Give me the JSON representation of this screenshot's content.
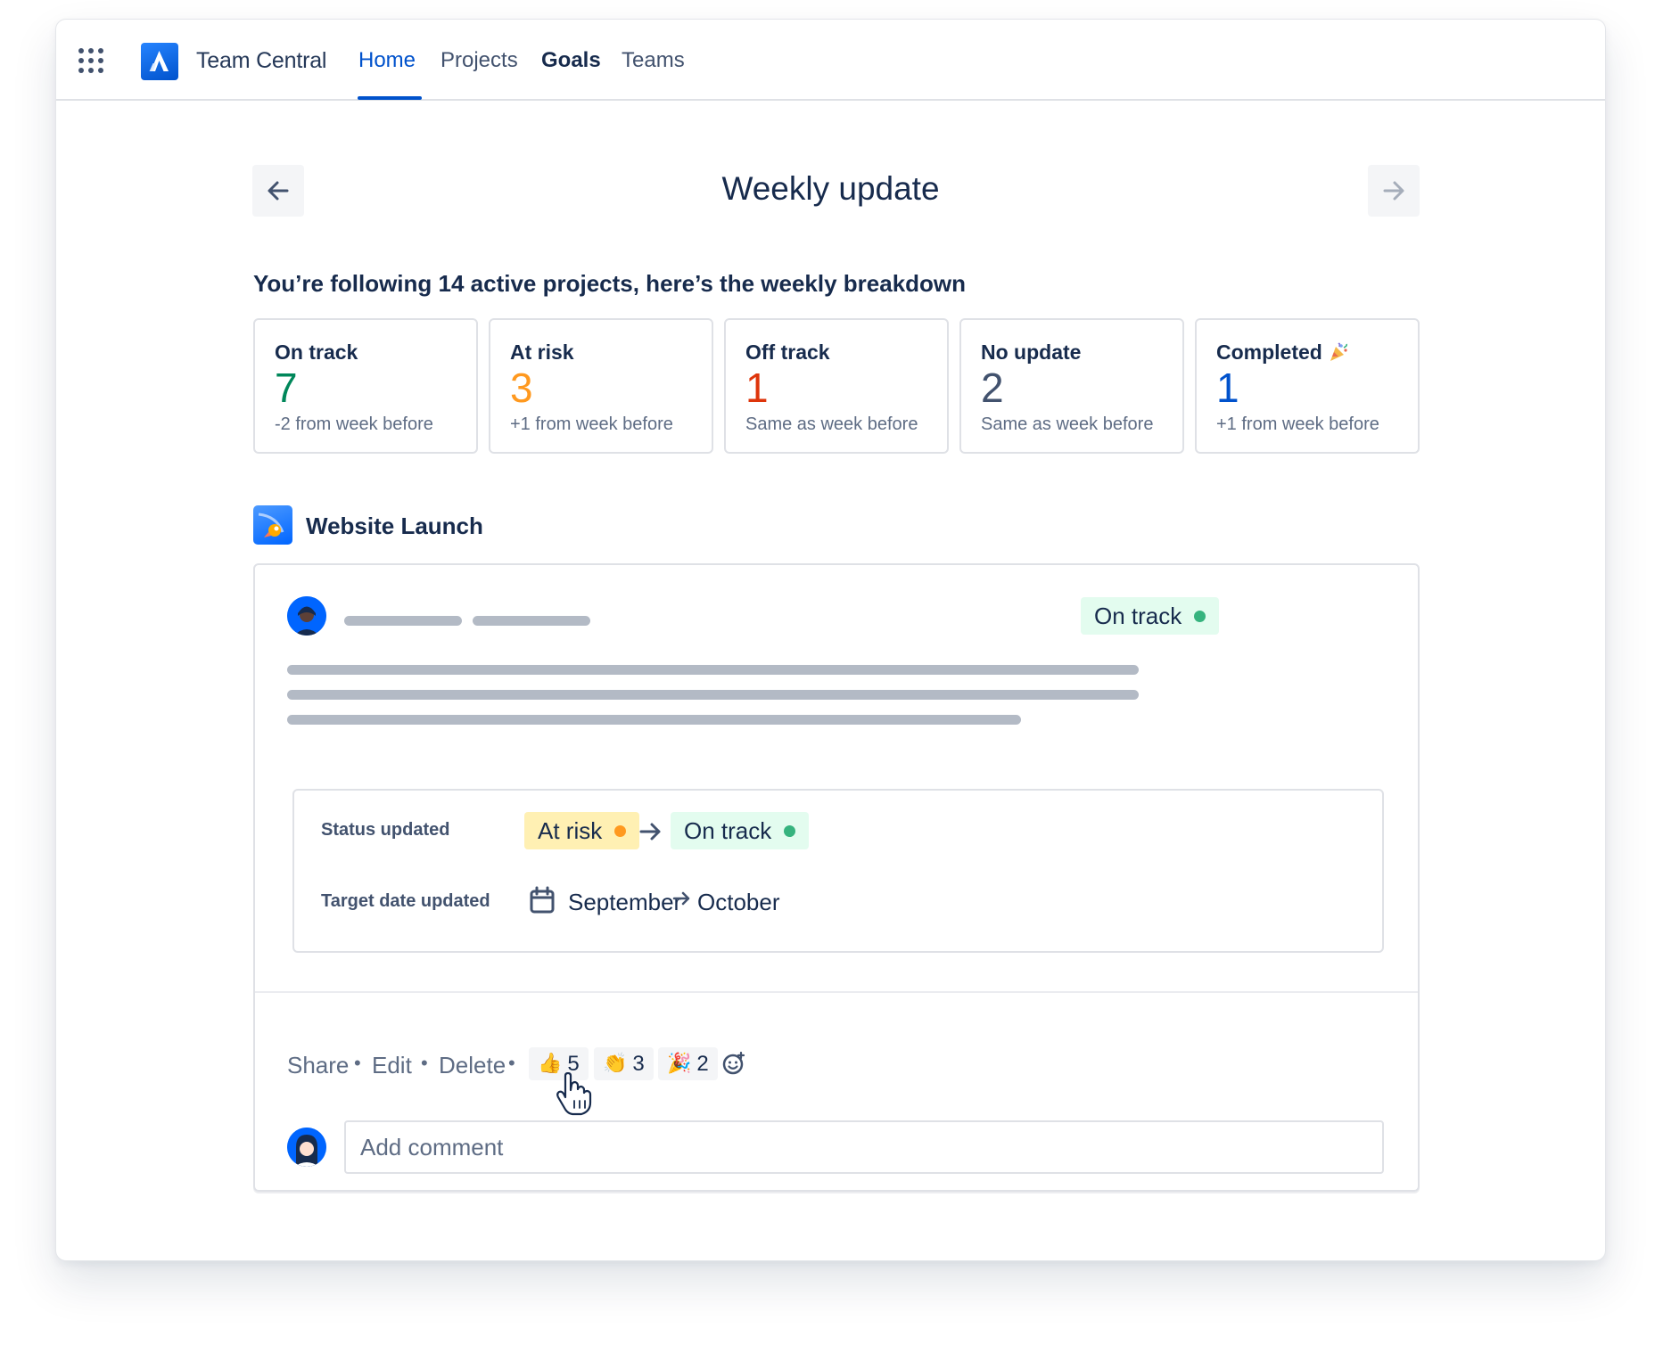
{
  "nav": {
    "brand": "Team Central",
    "items": [
      {
        "label": "Home",
        "active": true
      },
      {
        "label": "Projects"
      },
      {
        "label": "Goals"
      },
      {
        "label": "Teams"
      }
    ]
  },
  "header": {
    "title": "Weekly update",
    "subtitle": "You’re following 14 active projects, here’s the weekly breakdown"
  },
  "summary": [
    {
      "label": "On track",
      "value": "7",
      "delta": "-2 from week before",
      "color": "#00875A"
    },
    {
      "label": "At risk",
      "value": "3",
      "delta": "+1 from week before",
      "color": "#FF991F"
    },
    {
      "label": "Off track",
      "value": "1",
      "delta": "Same as week before",
      "color": "#DE350B"
    },
    {
      "label": "No update",
      "value": "2",
      "delta": "Same as week before",
      "color": "#42526E"
    },
    {
      "label": "Completed",
      "value": "1",
      "delta": "+1 from week before",
      "color": "#0052CC",
      "icon": "party-popper-icon"
    }
  ],
  "project": {
    "name": "Website Launch",
    "status": {
      "label": "On track",
      "color": "#36B37E"
    },
    "changes": {
      "status_label": "Status updated",
      "status_from": "At risk",
      "status_from_color": "#FF991F",
      "status_to": "On track",
      "status_to_color": "#36B37E",
      "date_label": "Target date updated",
      "date_from": "September",
      "date_to": "October"
    },
    "actions": [
      "Share",
      "Edit",
      "Delete"
    ],
    "reactions": [
      {
        "emoji": "👍",
        "icon": "thumbs-up-icon",
        "count": "5"
      },
      {
        "emoji": "👏",
        "icon": "clapping-hands-icon",
        "count": "3"
      },
      {
        "emoji": "🎉",
        "icon": "party-popper-icon",
        "count": "2"
      }
    ],
    "comment_placeholder": "Add comment"
  }
}
